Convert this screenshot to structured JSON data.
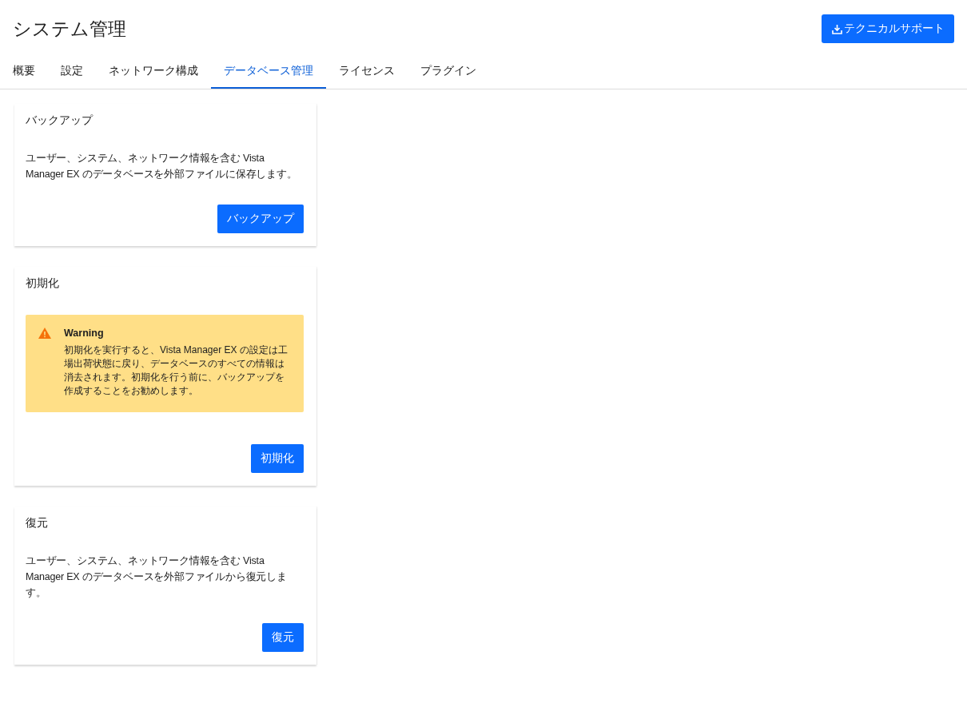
{
  "header": {
    "title": "システム管理",
    "support_button": "テクニカルサポート"
  },
  "tabs": [
    {
      "label": "概要",
      "selected": false
    },
    {
      "label": "設定",
      "selected": false
    },
    {
      "label": "ネットワーク構成",
      "selected": false
    },
    {
      "label": "データベース管理",
      "selected": true
    },
    {
      "label": "ライセンス",
      "selected": false
    },
    {
      "label": "プラグイン",
      "selected": false
    }
  ],
  "cards": [
    {
      "title": "バックアップ",
      "body": {
        "kind": "text",
        "text": "ユーザー、システム、ネットワーク情報を含む Vista Manager EX のデータベースを外部ファイルに保存します。"
      },
      "button": "バックアップ"
    },
    {
      "title": "初期化",
      "body": {
        "kind": "warning",
        "heading": "Warning",
        "text": "初期化を実行すると、Vista Manager EX の設定は工場出荷状態に戻り、データベースのすべての情報は消去されます。初期化を行う前に、バックアップを作成することをお勧めします。"
      },
      "button": "初期化"
    },
    {
      "title": "復元",
      "body": {
        "kind": "text",
        "text": "ユーザー、システム、ネットワーク情報を含む Vista Manager EX のデータベースを外部ファイルから復元します。"
      },
      "button": "復元"
    }
  ]
}
